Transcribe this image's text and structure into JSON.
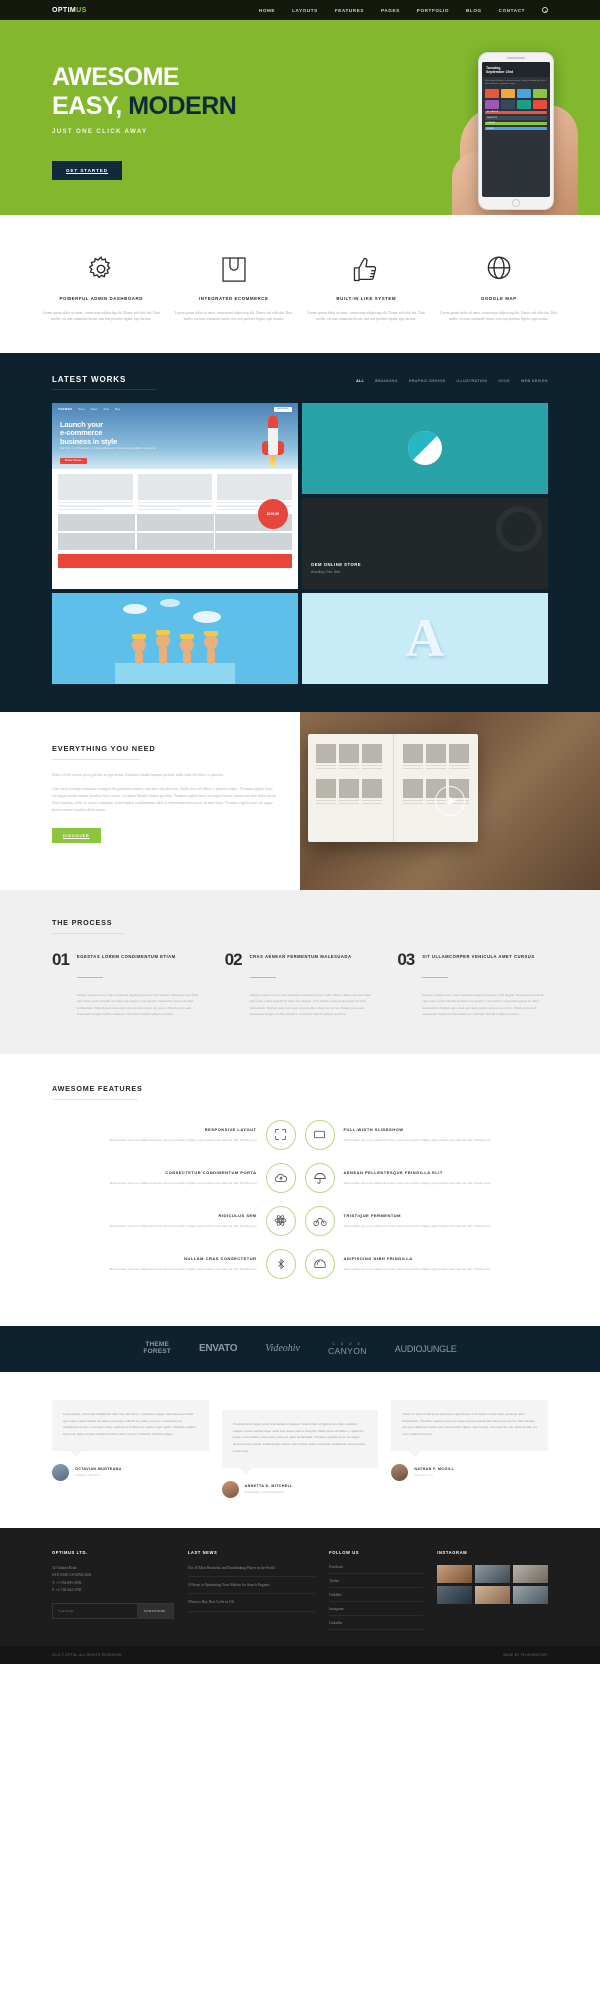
{
  "header": {
    "logo_main": "OPTIM",
    "logo_accent": "US",
    "nav": [
      "HOME",
      "LAYOUTS",
      "FEATURES",
      "PAGES",
      "PORTFOLIO",
      "BLOG",
      "CONTACT"
    ],
    "search_icon": "search-icon"
  },
  "hero": {
    "line1": "AWESOME",
    "line2_white": "EASY,",
    "line2_dark": "MODERN",
    "subtitle": "JUST ONE CLICK AWAY",
    "cta": "GET STARTED",
    "phone": {
      "day": "Tuesday,",
      "date": "September 23rd",
      "blurb": "Nulla vitae elit libero, a pharetra augue. Donec sed odio dui. Nulla vitae elit libero, a pharetra augue.",
      "tiles": [
        "ALLIANCE",
        "FASHION",
        "TRAVEL",
        "MUSIC"
      ]
    }
  },
  "features4": [
    {
      "icon": "gear-icon",
      "title": "POWERFUL ADMIN DASHBOARD",
      "text": "Lorem ipsum dolor sit amet, consectetur adipiscing elit. Donec sed odio dui. Duis mollis, est non commodo luctus, nisi erat porttitor ligula, eget lacinia."
    },
    {
      "icon": "shopping-bag-icon",
      "title": "INTEGRATED ECOMMERCE",
      "text": "Lorem ipsum dolor sit amet, consectetur adipiscing elit. Donec sed odio dui. Duis mollis, est non commodo luctus, nisi erat porttitor ligula, eget lacinia."
    },
    {
      "icon": "thumbs-up-icon",
      "title": "BUILT-IN LIKE SYSTEM",
      "text": "Lorem ipsum dolor sit amet, consectetur adipiscing elit. Donec sed odio dui. Duis mollis, est non commodo luctus, nisi erat porttitor ligula, eget lacinia."
    },
    {
      "icon": "globe-icon",
      "title": "GOOGLE MAP",
      "text": "Lorem ipsum dolor sit amet, consectetur adipiscing elit. Donec sed odio dui. Duis mollis, est non commodo luctus, nisi erat porttitor ligula, eget lacinia."
    }
  ],
  "works": {
    "title": "LATEST WORKS",
    "filters": [
      "ALL",
      "BRANDING",
      "GRAPHIC DESIGN",
      "ILLUSTRATION",
      "UI/UX",
      "WEB DESIGN"
    ],
    "active_filter": "ALL",
    "browser": {
      "brand": "THEMES",
      "nav": [
        "Home",
        "Pages",
        "Shop",
        "Blog"
      ],
      "cta": "BUY NOW",
      "headline_1": "Launch your",
      "headline_2": "e-commerce",
      "headline_3": "business in style",
      "sub": "Start with one of the demos, no coding skills needed. Online shopping platform ready to go.",
      "button": "Browse Themes",
      "price": "$245,00",
      "badge": "SALE"
    },
    "oem": {
      "title": "OEM ONLINE STORE",
      "subtitle": "Branding, Print, Web"
    },
    "letter": "A"
  },
  "everything": {
    "title": "EVERYTHING YOU NEED",
    "p1": "Donec id elit non mi porta gravida at eget metus. Curabitur blandit tempus porttitor nulla vitae elit libero, a pharetra.",
    "p2": "Cum sociis natoque penatibus et magnis dis parturient montes, nascetur ridiculus mus. Nulla vitae elit libero, a pharetra augue. Vivamus sagittis lacus vel augue laoreet rutrum faucibus dolor auctor. Curabitur blandit tempus porttitor. Vivamus sagittis lacus vel augue laoreet rutrum faucibus dolor auctor. Fusce dapibus, tellus ac cursus commodo, tortor mauris condimentum nibh, ut fermentum massa justo sit amet risus. Vivamus sagittis lacus vel augue laoreet rutrum faucibus dolor auctor.",
    "cta": "DISCOVER",
    "play_icon": "play-button-icon"
  },
  "process": {
    "title": "THE PROCESS",
    "steps": [
      {
        "num": "01",
        "title": "EGESTAS LOREM CONDIMENTUM ETIAM",
        "text": "Integer posuere erat a ante venenatis dapibus posuere velit aliquet. Maecenas sed diam eget risus varius blandit sit amet non magna. Cras mattis consectetur purus sit amet fermentum. Nullam quis risus eget urna mollis ornare vel eu leo. Etiam porta sem malesuada magna mollis euismod. Curabitur blandit tempus porttitor."
      },
      {
        "num": "02",
        "title": "CRAS AENEAN FERMENTUM MALESUADA",
        "text": "Integer posuere erat a ante venenatis dapibus posuere velit aliquet. Maecenas sed diam eget risus varius blandit sit amet non magna. Cras mattis consectetur purus sit amet fermentum. Nullam quis risus eget urna mollis ornare vel eu leo. Etiam porta sem malesuada magna mollis euismod. Curabitur blandit tempus porttitor."
      },
      {
        "num": "03",
        "title": "SIT ULLAMCORPER VEHICULA AMET CURSUS",
        "text": "Integer posuere erat a ante venenatis dapibus posuere velit aliquet. Maecenas sed diam eget risus varius blandit sit amet non magna. Cras mattis consectetur purus sit amet fermentum. Nullam quis risus eget urna mollis ornare vel eu leo. Etiam porta sem malesuada magna mollis euismod. Curabitur blandit tempus porttitor."
      }
    ]
  },
  "awesome": {
    "title": "AWESOME FEATURES",
    "body": "Duis mollis, est non commodo luctus, nisi erat porttitor ligula, eget lacinia odio sem nec elit. Etiam porta",
    "rows": [
      {
        "left_title": "RESPONSIVE LAYOUT",
        "left_icon": "responsive-icon",
        "right_icon": "slideshow-icon",
        "right_title": "FULL-WIDTH SLIDESHOW"
      },
      {
        "left_title": "CONSECTETUR CONDIMENTUM PORTA",
        "left_icon": "cloud-upload-icon",
        "right_icon": "umbrella-icon",
        "right_title": "AENEAN PELLENTESQUE FRINGILLA ELIT"
      },
      {
        "left_title": "RIDICULUS SEM",
        "left_icon": "atom-icon",
        "right_icon": "bicycle-icon",
        "right_title": "TRISTIQUE FERMENTUM"
      },
      {
        "left_title": "NULLAM CRAS CONSECTETUR",
        "left_icon": "bluetooth-icon",
        "right_icon": "helmet-icon",
        "right_title": "ADIPISCING NIBH FRINGILLA"
      }
    ]
  },
  "brands": [
    {
      "name": "THEME FOREST",
      "line1": "THEME",
      "line2": "FOREST"
    },
    {
      "name": "ENVATO"
    },
    {
      "name": "Videohiv"
    },
    {
      "name": "CODE CANYON",
      "small": "C O D E",
      "big": "CANYON"
    },
    {
      "name": "AUDIOJUNGLE"
    }
  ],
  "testimonials": [
    {
      "quote": "Great theme, clean and minimalist ulla vitae elit libero, a pharetra augue. Maecenas sed diam eget risus varius blandit sit amet non magna. Morbi leo risus, porta ac consectetur ac, vestibulum at eros. Cras justo odio, dapibus ac facilisis in, egestas eget quam. Vivamus sagittis lacus vel augue laoreet rutrum faucibus dolor auctor. Curabitur blandit tempus.",
      "name": "OCTAVIAN MUNTEANU",
      "location": "Chisinau, Moldova",
      "avatar": "avatar-octavian"
    },
    {
      "quote": "Vestibulum id ligula porta felis euismod semper. Vestibulum id ligula porta felis euismod semper. Donec ullamcorper nulla non metus auctor fringilla. Nulla vitae elit libero, a pharetra augue. Cras mattis consectetur purus sit amet fermentum. Vivamus sagittis lacus vel augue. Aenean eu leo quam. Pellentesque ornare sem lacinia quam venenatis vestibulum. Sed posuere consectetur",
      "name": "ANNETTA D. MITCHELL",
      "location": "Manchester, United Kingdom",
      "avatar": "avatar-annetta"
    },
    {
      "quote": "Donec id elit non mi porta gravida at eget metus. Cras mattis consectetur purus sit amet fermentum. Vivamus sagittis lacus vel augue laoreet rutrum faucibus dolor auctor. Duis mollis, est non commodo luctus, nisi erat porttitor ligula, eget lacinia odio sem nec elit. Duis mollis, est non commodo luctus.",
      "name": "NATHAN F. MCGILL",
      "location": "Missouri, U.S",
      "avatar": "avatar-nathan"
    }
  ],
  "footer": {
    "company": {
      "title": "OPTIMUS LTD.",
      "address_line1": "32 Oatland Road",
      "address_line2": "SAN JOSE CS 92926 4601",
      "phone": "T:  +1-354-895-4592",
      "fax": "F:  +1-745-442-2708",
      "email_placeholder": "Your Email",
      "subscribe": "SUBSCRIBE"
    },
    "news": {
      "title": "LAST NEWS",
      "items": [
        "The 20 Most Beautiful and Breathtaking Places in the World",
        "10 Steps to Optimizing Your Website for Search Engines",
        "Where to Buy Best Coffe in UK"
      ]
    },
    "follow": {
      "title": "FOLLOW US",
      "items": [
        "Facebook",
        "Twitter",
        "Dribbble",
        "Instagram",
        "Linkedin"
      ]
    },
    "instagram": {
      "title": "INSTAGRAM"
    }
  },
  "copyright": {
    "left": "2014 © OPTIM. ALL RIGHTS RESERVED.",
    "right": "MADE BY PIXINVENTORY"
  }
}
